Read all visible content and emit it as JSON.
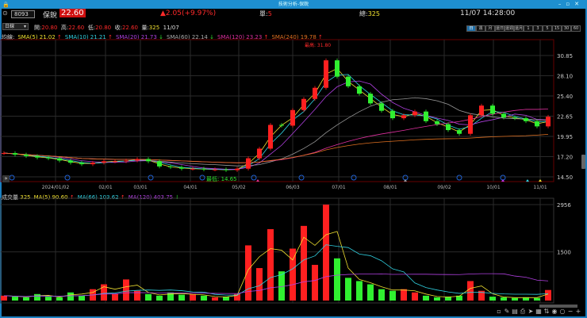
{
  "window": {
    "title": "技術分析-保銳",
    "lock_icon": "lock-icon",
    "controls": [
      "minimize",
      "restore",
      "close"
    ]
  },
  "quote": {
    "code": "8093",
    "name": "保銳",
    "price": "22.60",
    "change": "▲2.05(+9.97%)",
    "single_label": "單:",
    "single": "5",
    "total_label": "總:",
    "total": "325",
    "datetime": "11/07 14:28:00"
  },
  "ohlc": {
    "period_select": "日線",
    "open_label": "開:",
    "open": "20.80",
    "high_label": "高:",
    "high": "22.60",
    "low_label": "低:",
    "low": "20.80",
    "close_label": "收:",
    "close": "22.60",
    "vol_label": "量:",
    "vol": "325",
    "date": "11/07"
  },
  "periods": [
    "日",
    "週",
    "月",
    "還日",
    "還週",
    "還月",
    "1",
    "3",
    "5",
    "15",
    "30",
    "60"
  ],
  "ma_legend": {
    "label": "均線:",
    "items": [
      {
        "text": "SMA(5) 21.02",
        "arrow": "↑",
        "color": "#f0e030",
        "arrow_color": "#ff2a2a"
      },
      {
        "text": "SMA(10) 21.21",
        "arrow": "↑",
        "color": "#30d0e0",
        "arrow_color": "#ff2a2a"
      },
      {
        "text": "SMA(20) 21.73",
        "arrow": "↓",
        "color": "#b040e0",
        "arrow_color": "#2fe02f"
      },
      {
        "text": "SMA(60) 22.14",
        "arrow": "↓",
        "color": "#aaaaaa",
        "arrow_color": "#2fe02f"
      },
      {
        "text": "SMA(120) 23.23",
        "arrow": "↑",
        "color": "#e030a0",
        "arrow_color": "#ff2a2a"
      },
      {
        "text": "SMA(240) 19.78",
        "arrow": "↑",
        "color": "#e07020",
        "arrow_color": "#ff2a2a"
      }
    ]
  },
  "vol_legend": {
    "label": "成交量",
    "value": "325",
    "items": [
      {
        "text": "MA(5) 90.60",
        "arrow": "↑",
        "color": "#f0e030",
        "arrow_color": "#ff2a2a"
      },
      {
        "text": "MA(66) 103.62",
        "arrow": "↑",
        "color": "#30d0e0",
        "arrow_color": "#ff2a2a"
      },
      {
        "text": "MA(120) 403.75",
        "arrow": "↓",
        "color": "#b040e0",
        "arrow_color": "#2fe02f"
      }
    ]
  },
  "annotations": {
    "highest": "最高: 31.80",
    "lowest": "最低: 14.65"
  },
  "toolbar_icons": [
    "blank",
    "zoom-draw",
    "window",
    "print",
    "cursor",
    "grid",
    "stock",
    "eye",
    "circle",
    "minus",
    "plus"
  ],
  "chart_data": [
    {
      "type": "candlestick",
      "title": "",
      "ylim": [
        14.5,
        30.85
      ],
      "y_ticks": [
        "30.85",
        "28.10",
        "25.40",
        "22.65",
        "19.95",
        "17.20",
        "14.50"
      ],
      "x_ticks": [
        "2024/01/02",
        "02/01",
        "03/01",
        "04/01",
        "05/02",
        "06/03",
        "07/01",
        "08/01",
        "09/02",
        "10/01",
        "11/01"
      ],
      "colors": {
        "up": "#ff2020",
        "down": "#30f030"
      },
      "closes": [
        17.7,
        17.5,
        17.3,
        17.1,
        17.0,
        16.7,
        16.4,
        16.2,
        16.4,
        16.6,
        16.6,
        16.7,
        16.9,
        16.6,
        15.9,
        15.8,
        15.6,
        15.6,
        15.5,
        15.5,
        15.4,
        15.6,
        17.0,
        18.3,
        21.5,
        21.4,
        23.5,
        25.0,
        26.5,
        30.2,
        28.0,
        26.7,
        25.7,
        24.4,
        23.4,
        22.4,
        22.8,
        23.3,
        22.0,
        21.6,
        20.8,
        20.3,
        22.8,
        24.1,
        23.0,
        22.5,
        22.4,
        22.0,
        21.3,
        22.6
      ]
    },
    {
      "type": "bar",
      "title": "",
      "ylim": [
        0,
        2956
      ],
      "y_ticks": [
        "2956",
        "1500"
      ],
      "values": [
        150,
        120,
        100,
        200,
        120,
        100,
        250,
        150,
        350,
        500,
        200,
        650,
        300,
        200,
        150,
        250,
        180,
        200,
        150,
        100,
        120,
        200,
        1700,
        1000,
        2200,
        900,
        1600,
        2300,
        1100,
        2956,
        1300,
        700,
        600,
        500,
        350,
        300,
        350,
        250,
        150,
        100,
        120,
        150,
        600,
        300,
        120,
        100,
        80,
        100,
        80,
        325
      ]
    }
  ]
}
